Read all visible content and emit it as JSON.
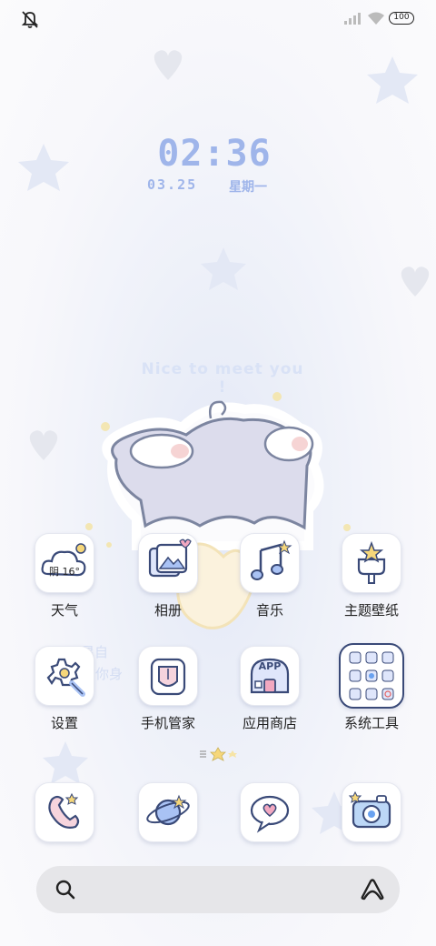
{
  "status_bar": {
    "battery_level": "100",
    "icons": [
      "mute-icon",
      "signal-icon",
      "wifi-icon",
      "battery-icon"
    ]
  },
  "clock": {
    "time": "02:36",
    "date": "03.25",
    "weekday": "星期一"
  },
  "wallpaper": {
    "tagline": "Nice to meet you !"
  },
  "apps": {
    "row1": [
      {
        "label": "天气",
        "weather_text": "阴 16°",
        "icon": "weather-icon"
      },
      {
        "label": "相册",
        "icon": "gallery-icon"
      },
      {
        "label": "音乐",
        "icon": "music-icon"
      },
      {
        "label": "主题壁纸",
        "icon": "theme-icon"
      }
    ],
    "row2": [
      {
        "label": "设置",
        "icon": "settings-icon"
      },
      {
        "label": "手机管家",
        "icon": "security-icon"
      },
      {
        "label": "应用商店",
        "icon": "app-store-icon",
        "badge": "APP"
      },
      {
        "label": "系统工具",
        "icon": "tools-folder-icon"
      }
    ]
  },
  "dock": [
    {
      "icon": "phone-icon"
    },
    {
      "icon": "browser-icon"
    },
    {
      "icon": "messages-icon"
    },
    {
      "icon": "camera-icon"
    }
  ],
  "colors": {
    "accent": "#9fb5ea",
    "outline": "#3a4a78",
    "label": "#222222"
  }
}
